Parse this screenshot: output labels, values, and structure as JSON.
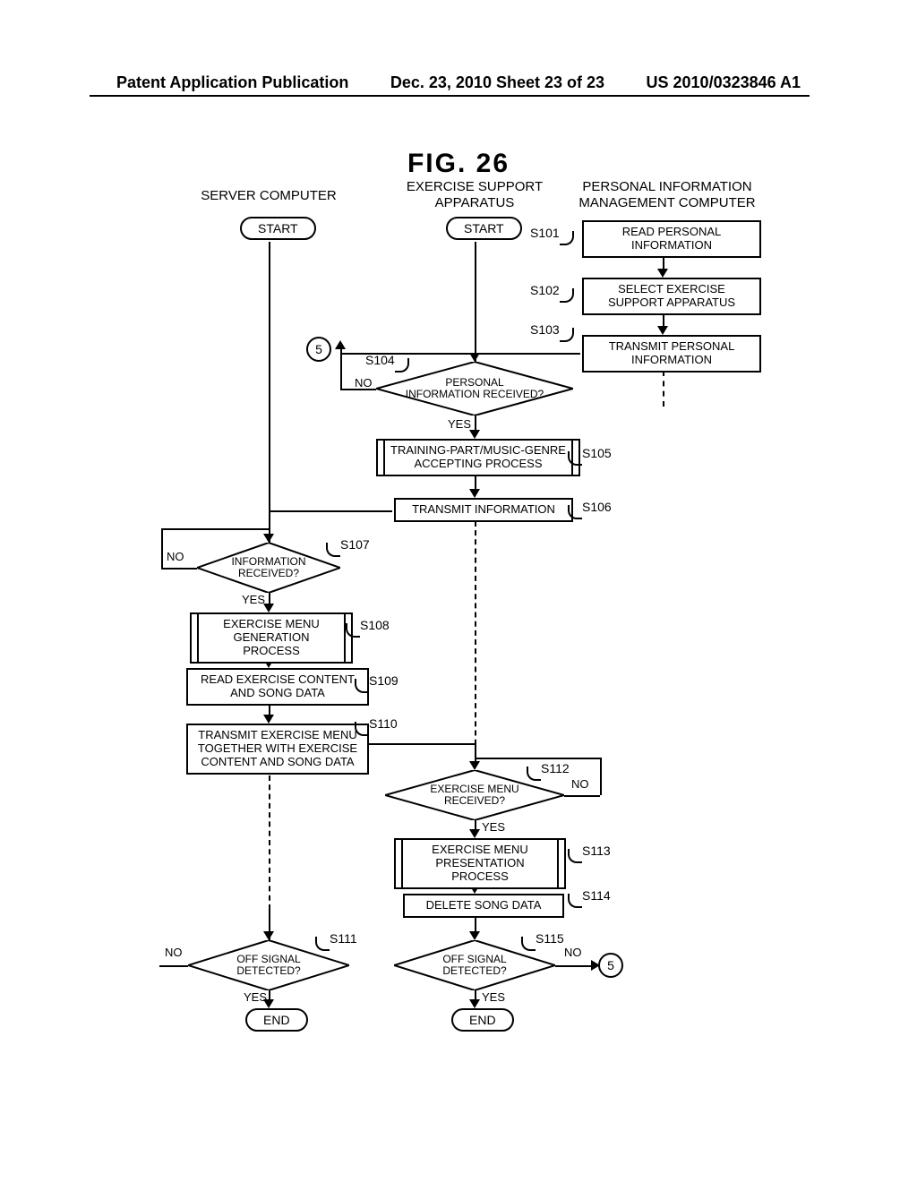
{
  "header": {
    "left": "Patent Application Publication",
    "mid": "Dec. 23, 2010  Sheet 23 of 23",
    "right": "US 2010/0323846 A1"
  },
  "figure_title": "FIG. 26",
  "columns": {
    "server": "SERVER COMPUTER",
    "esa": "EXERCISE SUPPORT\nAPPARATUS",
    "pim": "PERSONAL INFORMATION\nMANAGEMENT COMPUTER"
  },
  "terminals": {
    "start": "START",
    "end": "END"
  },
  "labels": {
    "yes": "YES",
    "no": "NO"
  },
  "connector": "5",
  "steps": {
    "s101": {
      "id": "S101",
      "text": "READ PERSONAL\nINFORMATION"
    },
    "s102": {
      "id": "S102",
      "text": "SELECT EXERCISE\nSUPPORT APPARATUS"
    },
    "s103": {
      "id": "S103",
      "text": "TRANSMIT PERSONAL\nINFORMATION"
    },
    "s104": {
      "id": "S104",
      "text": "PERSONAL\nINFORMATION RECEIVED?"
    },
    "s105": {
      "id": "S105",
      "text": "TRAINING-PART/MUSIC-GENRE\nACCEPTING PROCESS"
    },
    "s106": {
      "id": "S106",
      "text": "TRANSMIT INFORMATION"
    },
    "s107": {
      "id": "S107",
      "text": "INFORMATION\nRECEIVED?"
    },
    "s108": {
      "id": "S108",
      "text": "EXERCISE MENU\nGENERATION PROCESS"
    },
    "s109": {
      "id": "S109",
      "text": "READ EXERCISE CONTENT\nAND SONG DATA"
    },
    "s110": {
      "id": "S110",
      "text": "TRANSMIT EXERCISE MENU\nTOGETHER WITH EXERCISE\nCONTENT AND SONG DATA"
    },
    "s111": {
      "id": "S111",
      "text": "OFF SIGNAL\nDETECTED?"
    },
    "s112": {
      "id": "S112",
      "text": "EXERCISE MENU\nRECEIVED?"
    },
    "s113": {
      "id": "S113",
      "text": "EXERCISE MENU\nPRESENTATION PROCESS"
    },
    "s114": {
      "id": "S114",
      "text": "DELETE SONG DATA"
    },
    "s115": {
      "id": "S115",
      "text": "OFF SIGNAL\nDETECTED?"
    }
  }
}
